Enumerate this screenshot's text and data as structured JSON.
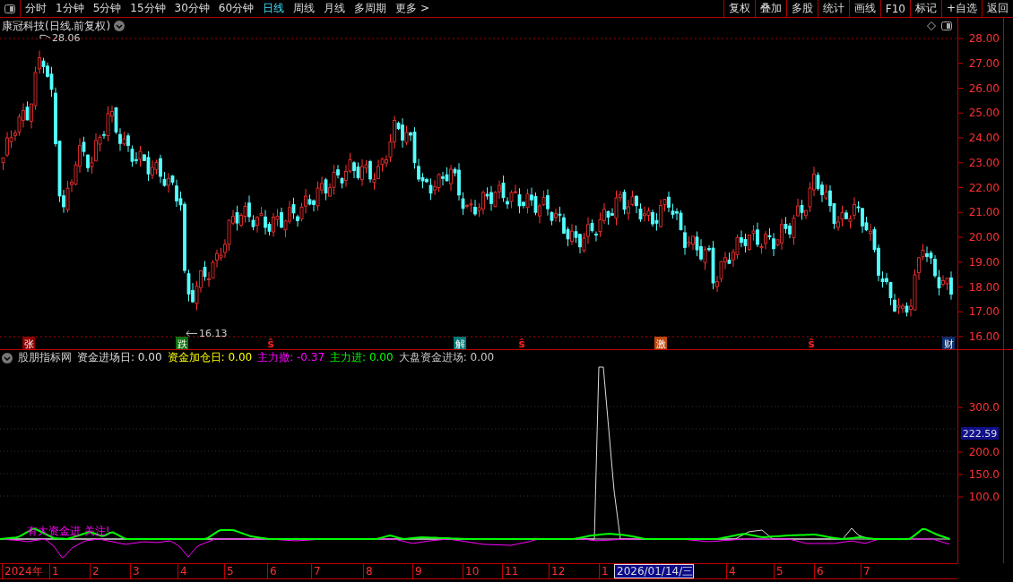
{
  "toolbar": {
    "periods": [
      {
        "label": "分时",
        "selected": false
      },
      {
        "label": "1分钟",
        "selected": false
      },
      {
        "label": "5分钟",
        "selected": false
      },
      {
        "label": "15分钟",
        "selected": false
      },
      {
        "label": "30分钟",
        "selected": false
      },
      {
        "label": "60分钟",
        "selected": false
      },
      {
        "label": "日线",
        "selected": true
      },
      {
        "label": "周线",
        "selected": false
      },
      {
        "label": "月线",
        "selected": false
      },
      {
        "label": "多周期",
        "selected": false
      },
      {
        "label": "更多 >",
        "selected": false
      }
    ],
    "actions": [
      "复权",
      "叠加",
      "多股",
      "统计",
      "画线",
      "F10",
      "标记",
      "+自选",
      "返回"
    ]
  },
  "price_chart": {
    "title": "康冠科技(日线.前复权)",
    "high_label": "28.06",
    "low_label": "16.13",
    "axis_labels": [
      "28.00",
      "27.00",
      "26.00",
      "25.00",
      "24.00",
      "23.00",
      "22.00",
      "21.00",
      "20.00",
      "19.00",
      "18.00",
      "17.00",
      "16.00"
    ],
    "markers": [
      {
        "text": "张",
        "kind": "tag",
        "color": "#8b0000"
      },
      {
        "text": "跌",
        "kind": "tag",
        "color": "#107010"
      },
      {
        "text": "ŝ",
        "kind": "signal",
        "color": "#ff2020"
      },
      {
        "text": "解",
        "kind": "tag",
        "color": "#007878"
      },
      {
        "text": "ŝ",
        "kind": "signal",
        "color": "#ff2020"
      },
      {
        "text": "激",
        "kind": "tag",
        "color": "#c04a10"
      },
      {
        "text": "ŝ",
        "kind": "signal",
        "color": "#ff2020"
      },
      {
        "text": "财",
        "kind": "tag",
        "color": "#10306e"
      }
    ]
  },
  "indicator": {
    "name": "股朋指标网",
    "readouts": [
      {
        "text": "资金进场日: 0.00",
        "color": "#dcdcdc"
      },
      {
        "text": "资金加仓日: 0.00",
        "color": "#ffff00"
      },
      {
        "text": "主力撤: -0.37",
        "color": "#ff00ff"
      },
      {
        "text": "主力进: 0.00",
        "color": "#00ff00"
      },
      {
        "text": "大盘资金进场: 0.00",
        "color": "#c8c8c8"
      }
    ],
    "axis_labels": [
      "300.0",
      "200.0",
      "150.0",
      "100.0"
    ],
    "current_value": "222.59",
    "signal_text": "有大资金进 关注!"
  },
  "time_axis": {
    "labels": [
      {
        "text": "2024年",
        "kind": "month"
      },
      {
        "text": "1",
        "kind": "month"
      },
      {
        "text": "2",
        "kind": "month"
      },
      {
        "text": "3",
        "kind": "month"
      },
      {
        "text": "4",
        "kind": "month"
      },
      {
        "text": "5",
        "kind": "month"
      },
      {
        "text": "6",
        "kind": "month"
      },
      {
        "text": "7",
        "kind": "month"
      },
      {
        "text": "8",
        "kind": "month"
      },
      {
        "text": "9",
        "kind": "month"
      },
      {
        "text": "10",
        "kind": "month"
      },
      {
        "text": "11",
        "kind": "month"
      },
      {
        "text": "12",
        "kind": "month"
      },
      {
        "text": "1",
        "kind": "month"
      },
      {
        "text": "2026/01/14/三",
        "kind": "cursor"
      },
      {
        "text": "4",
        "kind": "month"
      },
      {
        "text": "5",
        "kind": "month"
      },
      {
        "text": "6",
        "kind": "month"
      },
      {
        "text": "7",
        "kind": "month"
      }
    ]
  }
}
